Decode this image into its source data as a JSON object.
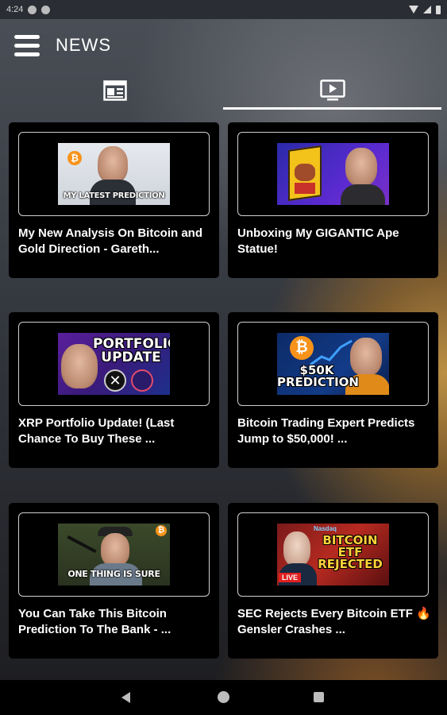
{
  "status_bar": {
    "time": "4:24"
  },
  "app_bar": {
    "title": "NEWS"
  },
  "tabs": [
    {
      "icon": "newspaper-icon",
      "selected": false
    },
    {
      "icon": "video-icon",
      "selected": true
    }
  ],
  "colors": {
    "accent_underline": "#ffffff",
    "card_bg": "#000000",
    "bitcoin_orange": "#f7931a"
  },
  "videos": [
    {
      "title": "My New Analysis On Bitcoin and Gold Direction - Gareth...",
      "thumbnail_text": "MY LATEST PREDICTION"
    },
    {
      "title": "Unboxing My GIGANTIC Ape Statue!",
      "thumbnail_text": ""
    },
    {
      "title": "XRP Portfolio Update! (Last Chance To Buy These ...",
      "thumbnail_text": "PORTFOLIO UPDATE"
    },
    {
      "title": "Bitcoin Trading Expert Predicts Jump to $50,000! ...",
      "thumbnail_text": "$50K PREDICTION"
    },
    {
      "title": "You Can Take This Bitcoin Prediction To The Bank - ...",
      "thumbnail_text": "ONE THING IS SURE"
    },
    {
      "title": "SEC Rejects Every Bitcoin ETF 🔥 Gensler Crashes ...",
      "thumbnail_text": "BITCOIN ETF REJECTED",
      "thumbnail_badge": "LIVE",
      "thumbnail_brand": "Nasdaq"
    }
  ]
}
